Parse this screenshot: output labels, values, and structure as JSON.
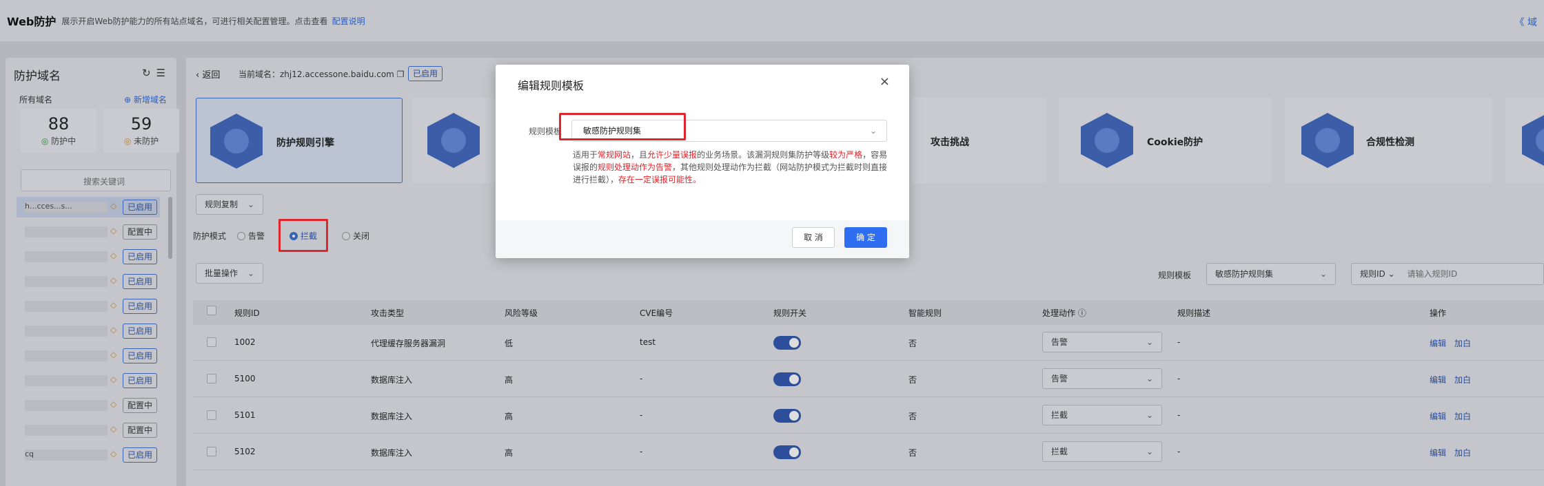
{
  "topbar": {
    "title": "Web防护",
    "desc": "展示开启Web防护能力的所有站点域名，可进行相关配置管理。点击查看",
    "link": "配置说明",
    "collapse": "《 域"
  },
  "sidebar": {
    "title": "防护域名",
    "all_label": "所有域名",
    "add_label": "⊕ 新增域名",
    "stat_protected": {
      "count": "88",
      "label": "防护中"
    },
    "stat_unprotected": {
      "count": "59",
      "label": "未防护"
    },
    "search_placeholder": "搜索关键词",
    "domains": [
      {
        "name": "h...cces...s...",
        "badge": "已启用"
      },
      {
        "name": "",
        "badge": "配置中"
      },
      {
        "name": "",
        "badge": "已启用"
      },
      {
        "name": "",
        "badge": "已启用"
      },
      {
        "name": "",
        "badge": "已启用"
      },
      {
        "name": "",
        "badge": "已启用"
      },
      {
        "name": "",
        "badge": "已启用"
      },
      {
        "name": "",
        "badge": "已启用"
      },
      {
        "name": "",
        "badge": "配置中"
      },
      {
        "name": "",
        "badge": "配置中"
      },
      {
        "name": "cq",
        "badge": "已启用"
      }
    ]
  },
  "main": {
    "back": "‹ 返回",
    "current_domain": "当前域名：zhj12.accessone.baidu.com ❐",
    "status": "已启用",
    "cards": [
      "防护规则引擎",
      "",
      "攻击挑战",
      "Cookie防护",
      "合规性检测"
    ],
    "copy_rules": "规则复制",
    "mode_label": "防护模式",
    "mode_alert": "告警",
    "mode_block": "拦截",
    "mode_off": "关闭",
    "batch": "批量操作",
    "template_label": "规则模板",
    "template_value": "敏感防护规则集",
    "filter_field": "规则ID",
    "filter_placeholder": "请输入规则ID",
    "columns": [
      "规则ID",
      "攻击类型",
      "风险等级",
      "CVE编号",
      "规则开关",
      "智能规则",
      "处理动作 ⓘ",
      "规则描述",
      "操作"
    ],
    "rows": [
      {
        "id": "1002",
        "type": "代理缓存服务器漏洞",
        "risk": "低",
        "cve": "test",
        "smart": "否",
        "action": "告警",
        "desc": "-"
      },
      {
        "id": "5100",
        "type": "数据库注入",
        "risk": "高",
        "cve": "-",
        "smart": "否",
        "action": "告警",
        "desc": "-"
      },
      {
        "id": "5101",
        "type": "数据库注入",
        "risk": "高",
        "cve": "-",
        "smart": "否",
        "action": "拦截",
        "desc": "-"
      },
      {
        "id": "5102",
        "type": "数据库注入",
        "risk": "高",
        "cve": "-",
        "smart": "否",
        "action": "拦截",
        "desc": "-"
      }
    ],
    "op_edit": "编辑",
    "op_whitelist": "加白"
  },
  "modal": {
    "title": "编辑规则模板",
    "close": "×",
    "label": "规则模板",
    "selected": "敏感防护规则集",
    "desc_1": "适用于",
    "desc_r1": "常规网站",
    "desc_2": "，且",
    "desc_r2": "允许少量误报",
    "desc_3": "的业务场景。该漏洞规则集防护等级",
    "desc_r3": "较为严格",
    "desc_4": "，容易误报的",
    "desc_r4": "规则处理动作为告警",
    "desc_5": "，其他规则处理动作为拦截（网站防护模式为拦截时则直接进行拦截），",
    "desc_r5": "存在一定误报可能性。",
    "cancel": "取 消",
    "ok": "确 定"
  }
}
